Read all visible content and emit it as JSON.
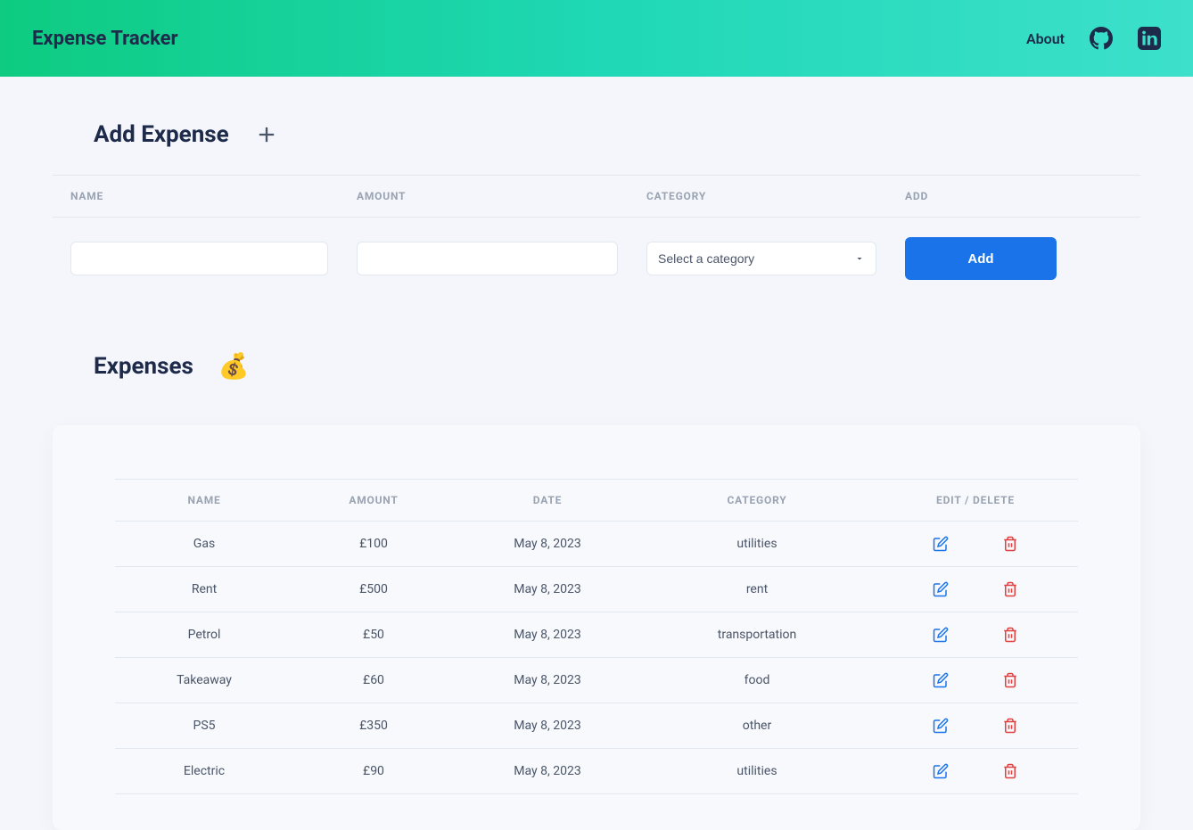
{
  "header": {
    "brand": "Expense Tracker",
    "about": "About"
  },
  "addSection": {
    "title": "Add Expense",
    "columns": {
      "name": "NAME",
      "amount": "AMOUNT",
      "category": "CATEGORY",
      "add": "ADD"
    },
    "categoryPlaceholder": "Select a category",
    "addButton": "Add"
  },
  "expensesSection": {
    "title": "Expenses",
    "columns": {
      "name": "NAME",
      "amount": "AMOUNT",
      "date": "DATE",
      "category": "CATEGORY",
      "actions": "EDIT / DELETE"
    },
    "rows": [
      {
        "name": "Gas",
        "amount": "£100",
        "date": "May 8, 2023",
        "category": "utilities"
      },
      {
        "name": "Rent",
        "amount": "£500",
        "date": "May 8, 2023",
        "category": "rent"
      },
      {
        "name": "Petrol",
        "amount": "£50",
        "date": "May 8, 2023",
        "category": "transportation"
      },
      {
        "name": "Takeaway",
        "amount": "£60",
        "date": "May 8, 2023",
        "category": "food"
      },
      {
        "name": "PS5",
        "amount": "£350",
        "date": "May 8, 2023",
        "category": "other"
      },
      {
        "name": "Electric",
        "amount": "£90",
        "date": "May 8, 2023",
        "category": "utilities"
      }
    ]
  }
}
